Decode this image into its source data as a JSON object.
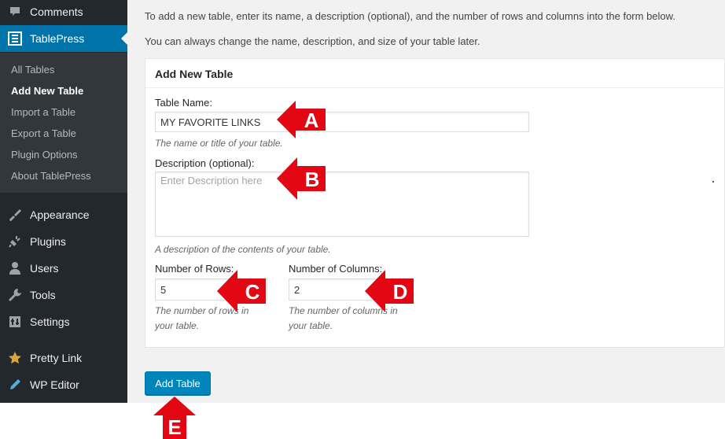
{
  "colors": {
    "sidebar_bg": "#23282d",
    "submenu_bg": "#32373c",
    "accent": "#0073aa",
    "button": "#0085ba",
    "annotation_red": "#e30613"
  },
  "sidebar": {
    "items_top": [
      {
        "label": "Comments",
        "icon": "comment-icon"
      },
      {
        "label": "TablePress",
        "icon": "table-icon",
        "current": true
      }
    ],
    "submenu": [
      "All Tables",
      "Add New Table",
      "Import a Table",
      "Export a Table",
      "Plugin Options",
      "About TablePress"
    ],
    "submenu_current": "Add New Table",
    "items_bottom": [
      {
        "label": "Appearance",
        "icon": "paintbrush-icon"
      },
      {
        "label": "Plugins",
        "icon": "plug-icon"
      },
      {
        "label": "Users",
        "icon": "user-icon"
      },
      {
        "label": "Tools",
        "icon": "wrench-icon"
      },
      {
        "label": "Settings",
        "icon": "settings-icon"
      },
      {
        "label": "Pretty Link",
        "icon": "star-icon"
      },
      {
        "label": "WP Editor",
        "icon": "pencil-icon"
      }
    ]
  },
  "intro": {
    "line1": "To add a new table, enter its name, a description (optional), and the number of rows and columns into the form below.",
    "line2": "You can always change the name, description, and size of your table later."
  },
  "form": {
    "title": "Add New Table",
    "name": {
      "label": "Table Name:",
      "value": "MY FAVORITE LINKS",
      "hint": "The name or title of your table."
    },
    "description": {
      "label": "Description (optional):",
      "placeholder": "Enter Description here",
      "hint": "A description of the contents of your table."
    },
    "rows": {
      "label": "Number of Rows:",
      "value": "5",
      "hint_line1": "The number of rows in",
      "hint_line2": "your table."
    },
    "columns": {
      "label": "Number of Columns:",
      "value": "2",
      "hint_line1": "The number of columns in",
      "hint_line2": "your table."
    },
    "submit_label": "Add Table"
  },
  "annotations": {
    "a": "A",
    "b": "B",
    "c": "C",
    "d": "D",
    "e": "E"
  }
}
